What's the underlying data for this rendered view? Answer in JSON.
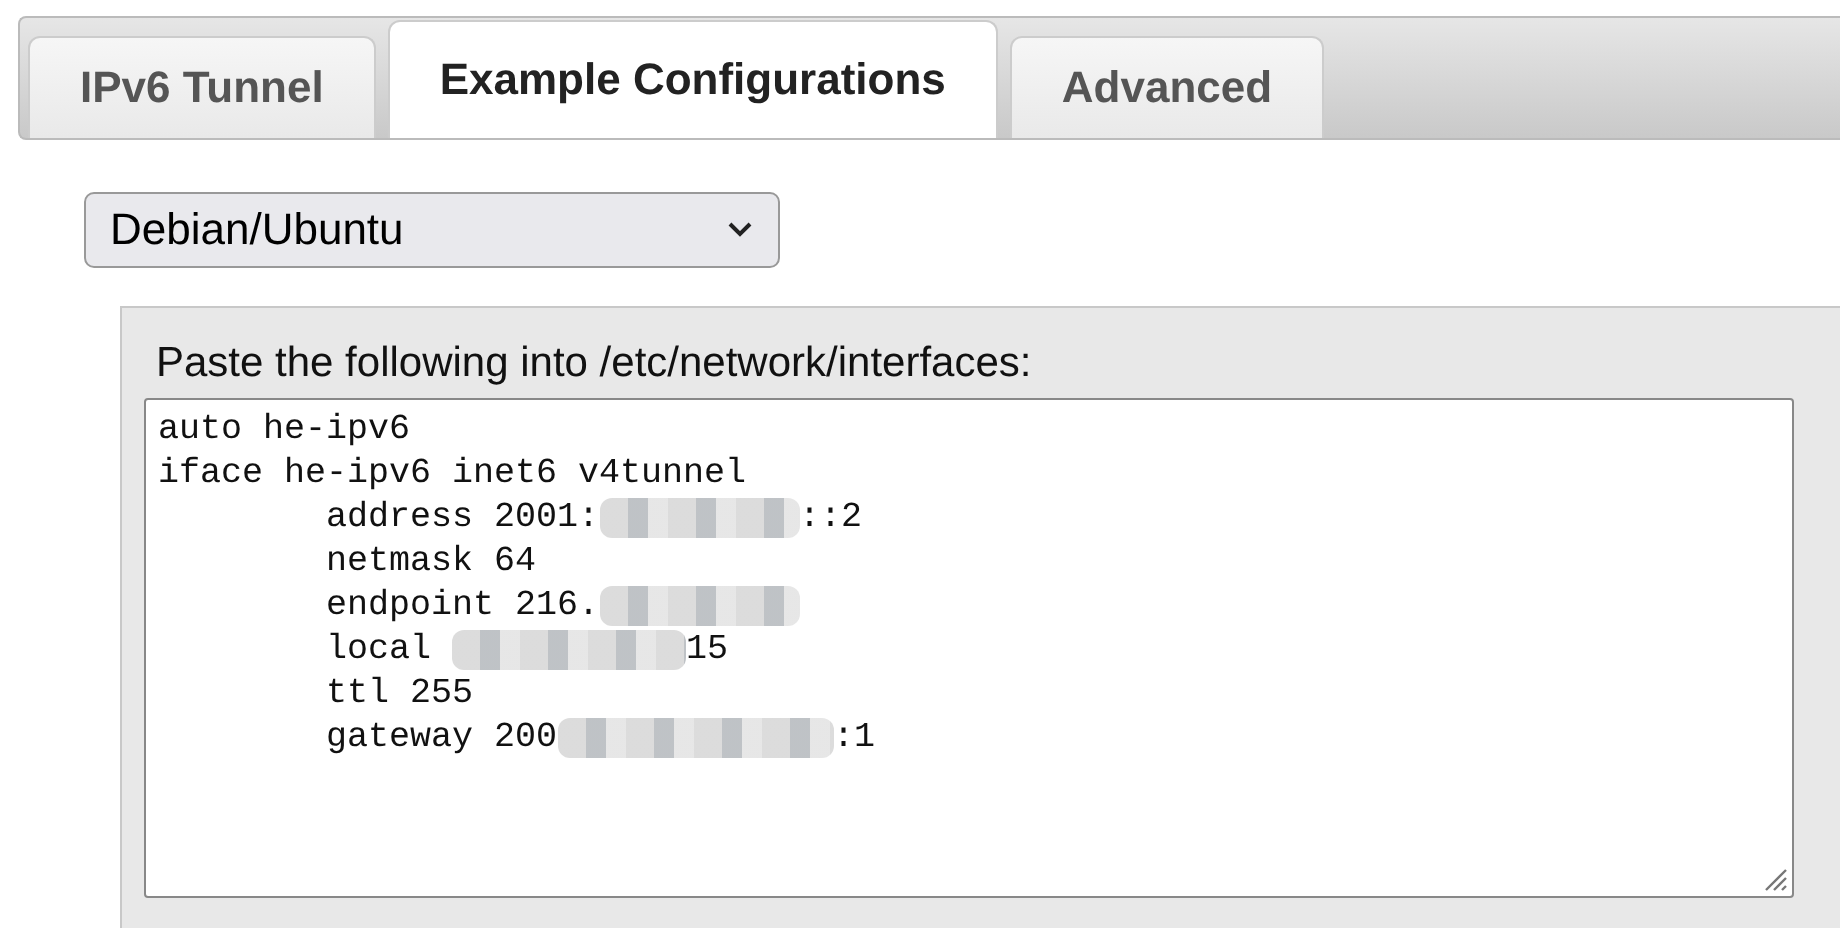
{
  "tabs": [
    {
      "label": "IPv6 Tunnel",
      "selected": false
    },
    {
      "label": "Example Configurations",
      "selected": true
    },
    {
      "label": "Advanced",
      "selected": false
    }
  ],
  "os_select": {
    "value": "Debian/Ubuntu"
  },
  "config_panel": {
    "label": "Paste the following into /etc/network/interfaces:",
    "lines": [
      [
        {
          "kind": "text",
          "text": "auto he-ipv6"
        }
      ],
      [
        {
          "kind": "text",
          "text": "iface he-ipv6 inet6 v4tunnel"
        }
      ],
      [
        {
          "kind": "text",
          "text": "        address 2001:"
        },
        {
          "kind": "short-blur"
        },
        {
          "kind": "text",
          "text": "::2"
        }
      ],
      [
        {
          "kind": "text",
          "text": "        netmask 64"
        }
      ],
      [
        {
          "kind": "text",
          "text": "        endpoint 216."
        },
        {
          "kind": "short-blur"
        }
      ],
      [
        {
          "kind": "text",
          "text": "        local "
        },
        {
          "kind": "medium-blur"
        },
        {
          "kind": "text",
          "text": "15"
        }
      ],
      [
        {
          "kind": "text",
          "text": "        ttl 255"
        }
      ],
      [
        {
          "kind": "text",
          "text": "        gateway 200"
        },
        {
          "kind": "long-blur"
        },
        {
          "kind": "text",
          "text": ":1"
        }
      ]
    ]
  }
}
